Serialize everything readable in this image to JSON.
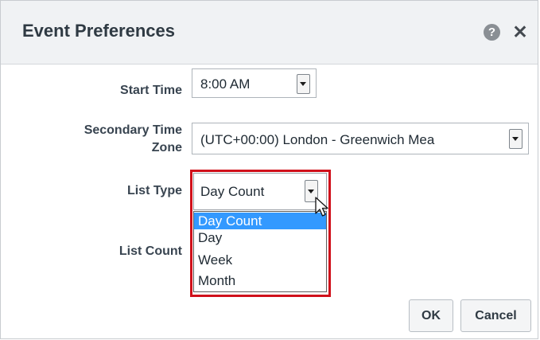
{
  "dialog": {
    "title": "Event Preferences",
    "help_icon": "question-mark",
    "close_icon": "x"
  },
  "form": {
    "start_time": {
      "label": "Start Time",
      "value": "8:00 AM"
    },
    "secondary_time_zone": {
      "label_line1": "Secondary Time",
      "label_line2": "Zone",
      "value": "(UTC+00:00) London - Greenwich Mea"
    },
    "list_type": {
      "label": "List Type",
      "value": "Day Count",
      "options": [
        "Day Count",
        "Day",
        "Week",
        "Month"
      ],
      "selected_option": "Day Count"
    },
    "list_count": {
      "label": "List Count"
    }
  },
  "buttons": {
    "ok": "OK",
    "cancel": "Cancel"
  },
  "colors": {
    "highlight_border": "#d0101a",
    "selected_option_bg": "#3399ff",
    "title_bar_bg": "#f0f2f4"
  }
}
